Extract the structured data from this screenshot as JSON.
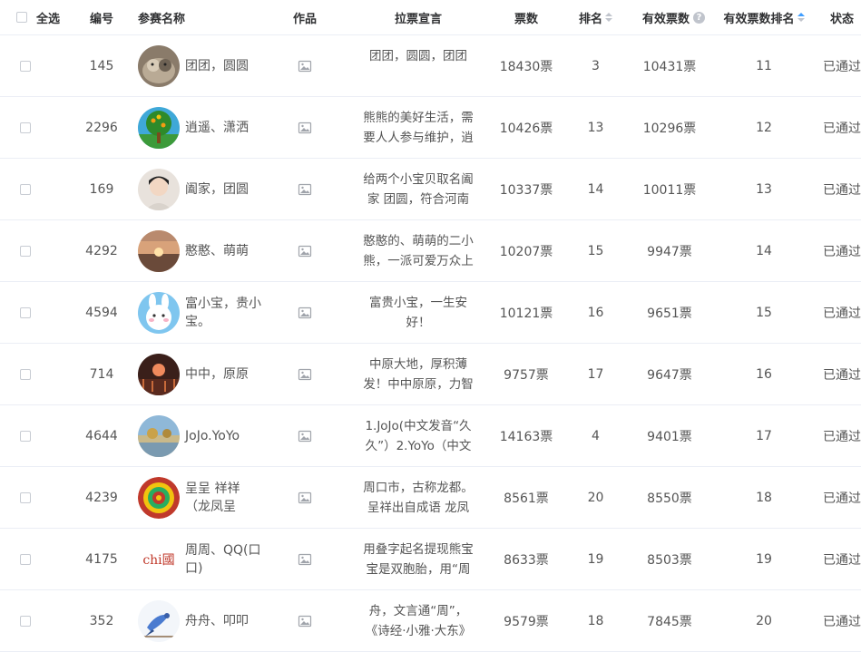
{
  "header": {
    "select_all": "全选",
    "number": "编号",
    "name": "参赛名称",
    "work": "作品",
    "slogan": "拉票宣言",
    "votes": "票数",
    "rank": "排名",
    "valid_votes": "有效票数",
    "valid_rank": "有效票数排名",
    "status": "状态"
  },
  "rows": [
    {
      "number": "145",
      "name": "团团，圆圆",
      "avatar": "avatar-cat",
      "slogan": "团团，圆圆，团团",
      "votes": "18430票",
      "rank": "3",
      "valid_votes": "10431票",
      "valid_rank": "11",
      "status": "已通过"
    },
    {
      "number": "2296",
      "name": "逍遥、潇洒",
      "avatar": "avatar-tree",
      "slogan": "熊熊的美好生活，需要人人参与维护，逍",
      "votes": "10426票",
      "rank": "13",
      "valid_votes": "10296票",
      "valid_rank": "12",
      "status": "已通过"
    },
    {
      "number": "169",
      "name": "阖家，团圆",
      "avatar": "avatar-person",
      "slogan": "给两个小宝贝取名阖家 团圆，符合河南",
      "votes": "10337票",
      "rank": "14",
      "valid_votes": "10011票",
      "valid_rank": "13",
      "status": "已通过"
    },
    {
      "number": "4292",
      "name": "憨憨、萌萌",
      "avatar": "avatar-sunset",
      "slogan": "憨憨的、萌萌的二小熊，一派可爱万众上",
      "votes": "10207票",
      "rank": "15",
      "valid_votes": "9947票",
      "valid_rank": "14",
      "status": "已通过"
    },
    {
      "number": "4594",
      "name": "富小宝，贵小宝。",
      "avatar": "avatar-bunny",
      "slogan": "富贵小宝，一生安好！",
      "votes": "10121票",
      "rank": "16",
      "valid_votes": "9651票",
      "valid_rank": "15",
      "status": "已通过"
    },
    {
      "number": "714",
      "name": "中中，原原",
      "avatar": "avatar-dark",
      "slogan": "中原大地，厚积薄发！中中原原，力智",
      "votes": "9757票",
      "rank": "17",
      "valid_votes": "9647票",
      "valid_rank": "16",
      "status": "已通过"
    },
    {
      "number": "4644",
      "name": "JoJo.YoYo",
      "avatar": "avatar-landscape",
      "slogan": "1.JoJo(中文发音“久久”）2.YoYo（中文",
      "votes": "14163票",
      "rank": "4",
      "valid_votes": "9401票",
      "valid_rank": "17",
      "status": "已通过"
    },
    {
      "number": "4239",
      "name": "呈呈 祥祥 （龙凤呈",
      "avatar": "avatar-mandala",
      "slogan": "周口市，古称龙都。呈祥出自成语 龙凤",
      "votes": "8561票",
      "rank": "20",
      "valid_votes": "8550票",
      "valid_rank": "18",
      "status": "已通过"
    },
    {
      "number": "4175",
      "name": "周周、QQ(口口)",
      "avatar": "avatar-china-logo",
      "slogan": "用叠字起名提现熊宝宝是双胞胎，用“周",
      "votes": "8633票",
      "rank": "19",
      "valid_votes": "8503票",
      "valid_rank": "19",
      "status": "已通过"
    },
    {
      "number": "352",
      "name": "舟舟、叩叩",
      "avatar": "avatar-bird",
      "slogan": "舟，文言通“周”，《诗经·小雅·大东》",
      "votes": "9579票",
      "rank": "18",
      "valid_votes": "7845票",
      "valid_rank": "20",
      "status": "已通过"
    }
  ],
  "avatar_logo_text": "chi國",
  "colors": {
    "accent": "#409eff",
    "border": "#ebeef5",
    "muted": "#c0c4cc"
  }
}
